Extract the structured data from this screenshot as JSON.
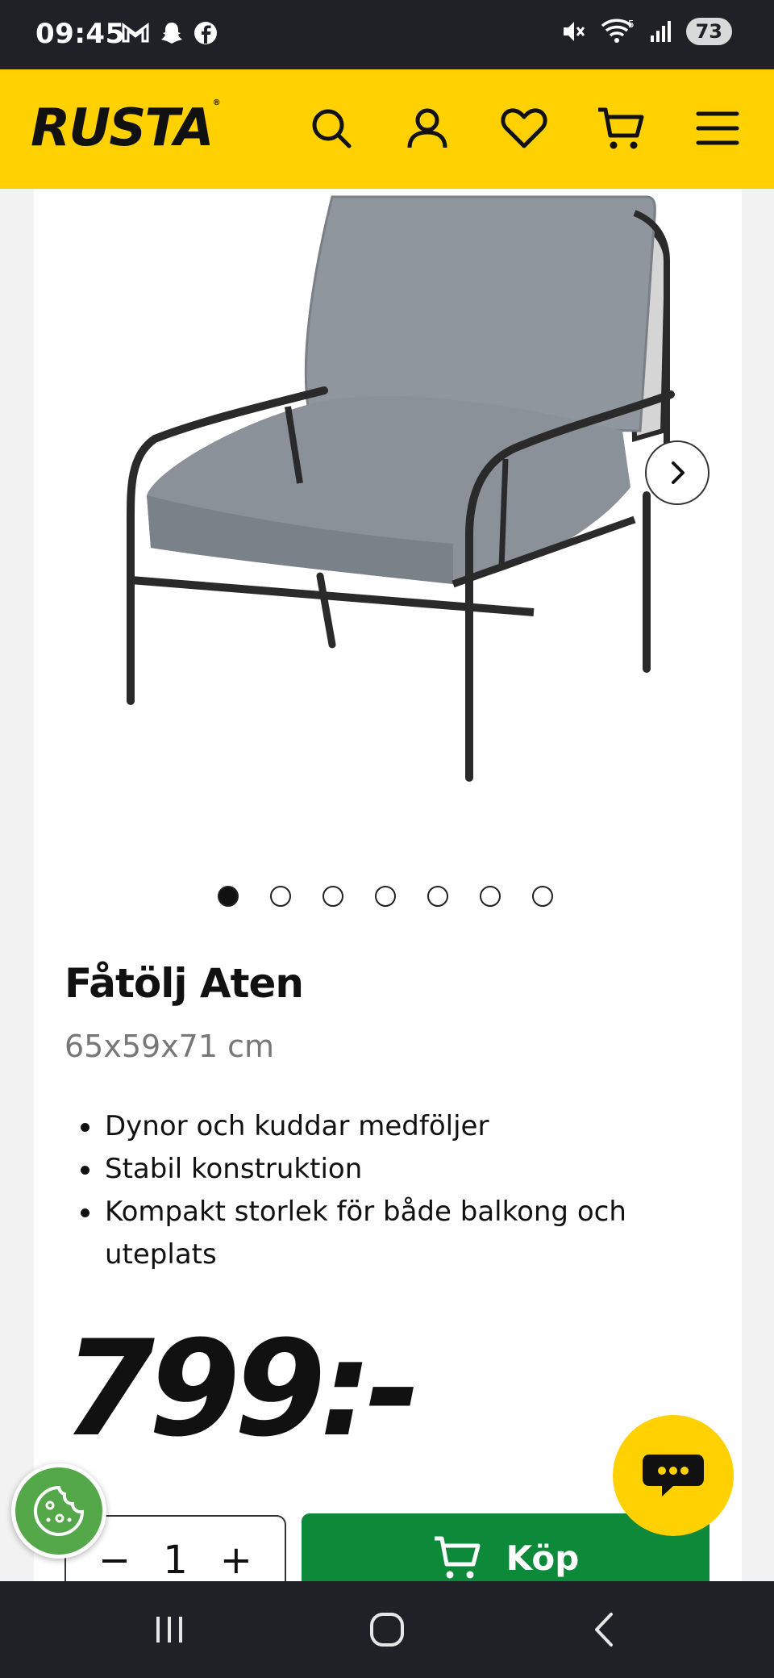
{
  "status_bar": {
    "time": "09:45",
    "battery": "73",
    "left_icons": [
      "gmail-icon",
      "snapchat-icon",
      "facebook-icon"
    ],
    "right_icons": [
      "mute-icon",
      "wifi-icon",
      "signal-icon"
    ]
  },
  "header": {
    "logo": "RUSTA",
    "logo_mark": "®",
    "icons": [
      "search-icon",
      "account-icon",
      "favorites-icon",
      "cart-icon",
      "menu-icon"
    ],
    "background": "#ffd100"
  },
  "gallery": {
    "image_count": 7,
    "active_index": 0
  },
  "product": {
    "title": "Fåtölj Aten",
    "size": "65x59x71 cm",
    "features": [
      "Dynor och kuddar medföljer",
      "Stabil konstruktion",
      "Kompakt storlek för både balkong och uteplats"
    ],
    "price": "799:-"
  },
  "purchase": {
    "qty_minus": "−",
    "quantity": "1",
    "qty_plus": "+",
    "buy_label": "Köp",
    "buy_color": "#0c8a3a"
  },
  "floating": {
    "cookie_color": "#55a84a",
    "chat_color": "#ffd100"
  }
}
